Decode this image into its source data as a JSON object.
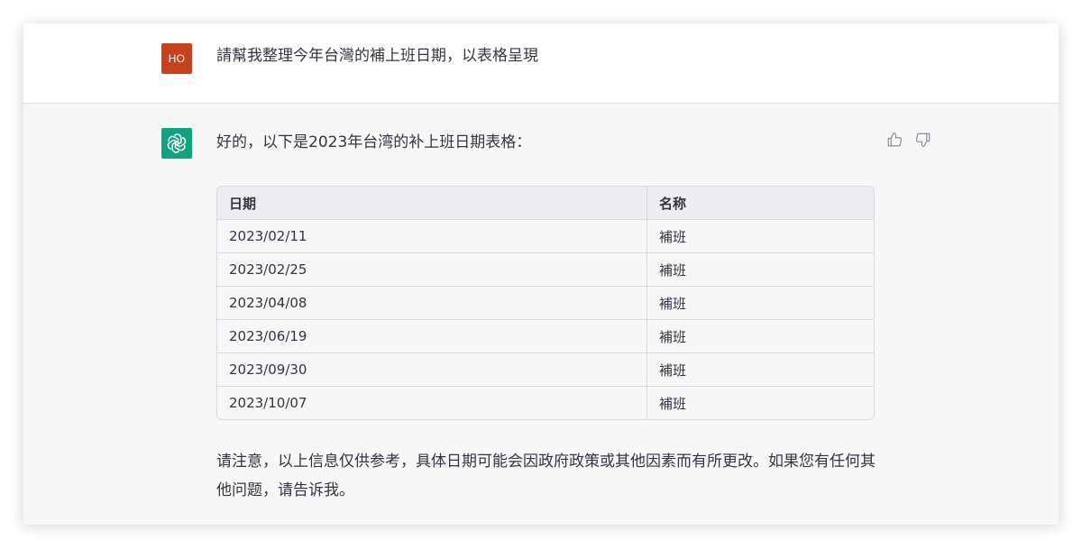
{
  "user_message": {
    "avatar_initials": "HO",
    "avatar_color": "#c6421d",
    "text": "請幫我整理今年台灣的補上班日期，以表格呈現"
  },
  "assistant_message": {
    "avatar_icon": "openai-logo-icon",
    "avatar_color": "#10a37f",
    "intro": "好的，以下是2023年台湾的补上班日期表格：",
    "table": {
      "headers": [
        "日期",
        "名称"
      ],
      "rows": [
        [
          "2023/02/11",
          "補班"
        ],
        [
          "2023/02/25",
          "補班"
        ],
        [
          "2023/04/08",
          "補班"
        ],
        [
          "2023/06/19",
          "補班"
        ],
        [
          "2023/09/30",
          "補班"
        ],
        [
          "2023/10/07",
          "補班"
        ]
      ]
    },
    "note": "请注意，以上信息仅供参考，具体日期可能会因政府政策或其他因素而有所更改。如果您有任何其他问题，请告诉我。"
  },
  "feedback": {
    "like_icon": "thumbs-up-icon",
    "dislike_icon": "thumbs-down-icon"
  }
}
